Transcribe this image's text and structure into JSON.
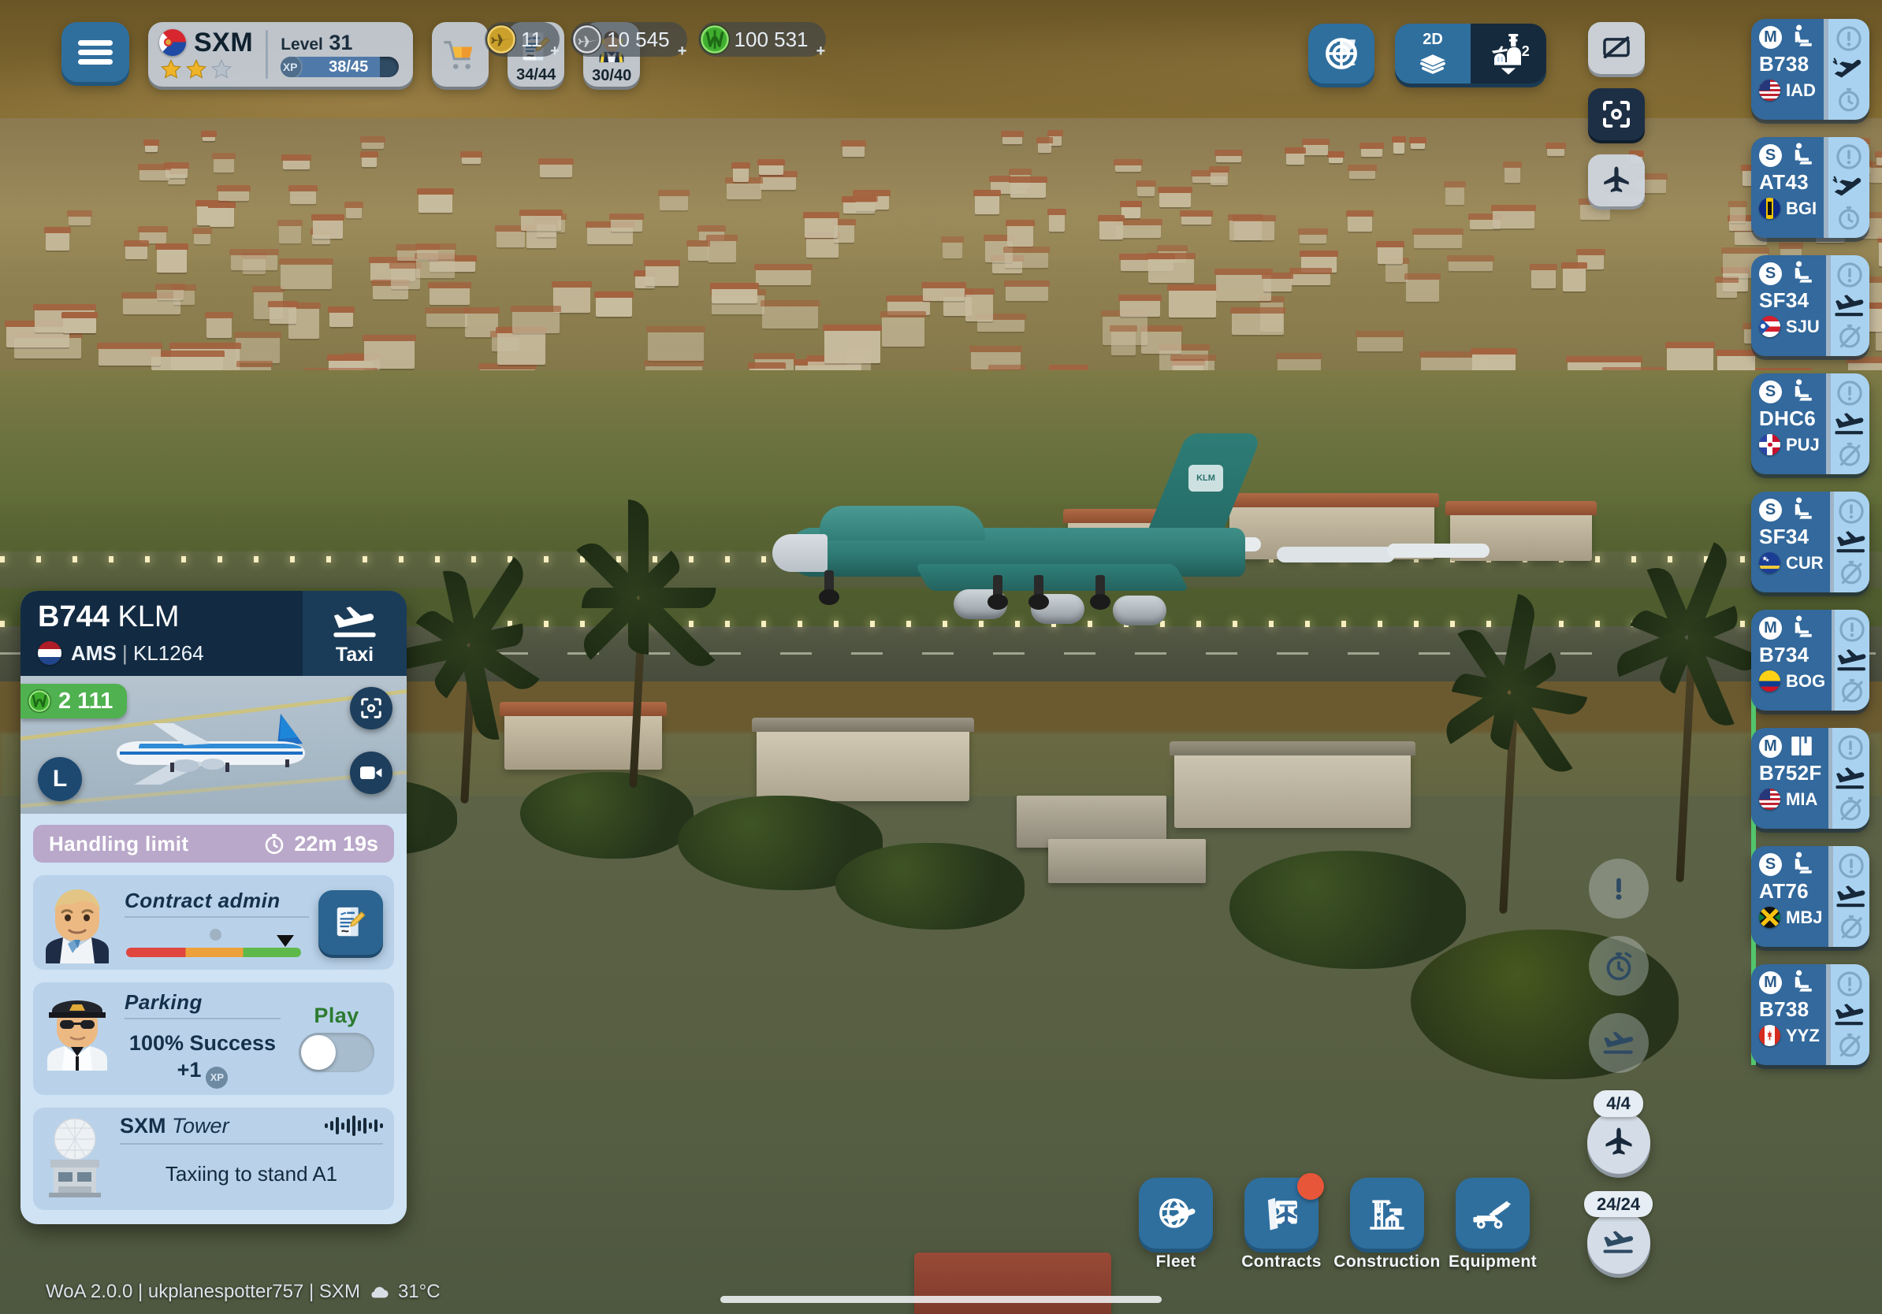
{
  "app": {
    "status_bar": "WoA 2.0.0 | ukplanespotter757 | SXM",
    "temperature": "31°C",
    "weather_icon": "cloud-icon"
  },
  "topbar": {
    "menu_icon": "hamburger-menu-icon",
    "airport": {
      "code": "SXM",
      "flag": "sint-maarten-flag",
      "stars_filled": 2,
      "stars_total": 3,
      "level_word": "Level",
      "level_number": "31",
      "xp_label": "XP",
      "xp_value": "38/45",
      "xp_percent": 84
    },
    "shop_button": {
      "icon": "shopping-cart-icon",
      "label": ""
    },
    "contracts_button": {
      "icon": "contract-document-icon",
      "count": "34/44"
    },
    "staff_button": {
      "icon": "ground-crew-icon",
      "count": "30/40"
    },
    "currencies": [
      {
        "name": "gold-plane-currency",
        "icon": "gold-plane-coin-icon",
        "value": "11",
        "color": "#caa12c"
      },
      {
        "name": "silver-plane-currency",
        "icon": "silver-plane-coin-icon",
        "value": "10 545",
        "color": "#b9bfc6"
      },
      {
        "name": "green-cash-currency",
        "icon": "green-w-coin-icon",
        "value": "100 531",
        "color": "#3fae2f"
      }
    ],
    "radar_button": {
      "icon": "radar-scope-icon"
    },
    "view_toggle": {
      "dimension_label": "2D",
      "dimension_icon": "layers-icon",
      "terminal_icon": "airport-terminal-icon",
      "terminal_count": "2",
      "chevron": "chevron-down-icon"
    },
    "right_controls": [
      {
        "name": "hide-labels-button",
        "icon": "screen-off-icon",
        "style": "light"
      },
      {
        "name": "focus-camera-button",
        "icon": "focus-frame-icon",
        "style": "dark"
      },
      {
        "name": "aircraft-filter-button",
        "icon": "plane-icon",
        "style": "light"
      }
    ]
  },
  "strips": [
    {
      "size": "M",
      "cargo_type": "passenger-seat-icon",
      "aircraft": "B738",
      "flag": "united-states-flag",
      "dest": "IAD",
      "movement": "departure-icon",
      "timer": "stopwatch-icon",
      "timer_disabled": false,
      "progress_pct": 28,
      "alert": "alert-circle-icon"
    },
    {
      "size": "S",
      "cargo_type": "passenger-seat-icon",
      "aircraft": "AT43",
      "flag": "barbados-flag",
      "dest": "BGI",
      "movement": "departure-icon",
      "timer": "stopwatch-icon",
      "timer_disabled": false,
      "progress_pct": 42,
      "alert": "alert-circle-icon"
    },
    {
      "size": "S",
      "cargo_type": "passenger-seat-icon",
      "aircraft": "SF34",
      "flag": "puerto-rico-flag",
      "dest": "SJU",
      "movement": "arrival-icon",
      "timer": "stopwatch-disabled-icon",
      "timer_disabled": true,
      "progress_pct": 0,
      "alert": "alert-circle-icon"
    },
    {
      "size": "S",
      "cargo_type": "passenger-seat-icon",
      "aircraft": "DHC6",
      "flag": "dominican-republic-flag",
      "dest": "PUJ",
      "movement": "arrival-icon",
      "timer": "stopwatch-disabled-icon",
      "timer_disabled": true,
      "progress_pct": 0,
      "alert": "alert-circle-icon"
    },
    {
      "size": "S",
      "cargo_type": "passenger-seat-icon",
      "aircraft": "SF34",
      "flag": "curacao-flag",
      "dest": "CUR",
      "movement": "arrival-icon",
      "timer": "stopwatch-disabled-icon",
      "timer_disabled": true,
      "progress_pct": 0,
      "alert": "alert-circle-icon"
    },
    {
      "size": "M",
      "cargo_type": "passenger-seat-icon",
      "aircraft": "B734",
      "flag": "colombia-flag",
      "dest": "BOG",
      "movement": "arrival-icon",
      "timer": "stopwatch-disabled-icon",
      "timer_disabled": true,
      "progress_pct": 0,
      "alert": "alert-circle-icon"
    },
    {
      "size": "M",
      "cargo_type": "cargo-boxes-icon",
      "aircraft": "B752F",
      "flag": "united-states-flag",
      "dest": "MIA",
      "movement": "arrival-icon",
      "timer": "stopwatch-disabled-icon",
      "timer_disabled": true,
      "progress_pct": 0,
      "alert": "alert-circle-icon"
    },
    {
      "size": "S",
      "cargo_type": "passenger-seat-icon",
      "aircraft": "AT76",
      "flag": "jamaica-flag",
      "dest": "MBJ",
      "movement": "arrival-icon",
      "timer": "stopwatch-disabled-icon",
      "timer_disabled": true,
      "progress_pct": 0,
      "alert": "alert-circle-icon"
    },
    {
      "size": "M",
      "cargo_type": "passenger-seat-icon",
      "aircraft": "B738",
      "flag": "canada-flag",
      "dest": "YYZ",
      "movement": "arrival-icon",
      "timer": "stopwatch-disabled-icon",
      "timer_disabled": true,
      "progress_pct": 0,
      "alert": "alert-circle-icon"
    }
  ],
  "aircraft_panel": {
    "type_code": "B744",
    "airline": "KLM",
    "origin_flag": "netherlands-flag",
    "origin": "AMS",
    "flight_number": "KL1264",
    "state_label": "Taxi",
    "state_icon": "landing-plane-icon",
    "reward_icon": "green-w-coin-icon",
    "reward_value": "2 111",
    "size_class": "L",
    "focus_icon": "focus-frame-icon",
    "camera_icon": "video-camera-icon",
    "handling": {
      "label": "Handling limit",
      "timer_icon": "stopwatch-icon",
      "time_left": "22m 19s"
    },
    "contract_admin": {
      "role": "Contract admin",
      "avatar": "contract-admin-avatar",
      "action_icon": "contract-document-icon",
      "skill_percent": 92
    },
    "parking": {
      "role": "Parking",
      "avatar": "pilot-avatar",
      "success_text": "100% Success",
      "xp_text": "+1",
      "xp_badge": "XP",
      "toggle_label": "Play",
      "toggle_on": false
    },
    "tower": {
      "airport": "SXM",
      "title_suffix": "Tower",
      "waveform_icon": "audio-waveform-icon",
      "message": "Taxiing to stand A1"
    }
  },
  "bottom_toolbar": [
    {
      "name": "fleet",
      "label": "Fleet",
      "icon": "globe-plane-icon",
      "badge": false
    },
    {
      "name": "contracts",
      "label": "Contracts",
      "icon": "tickets-icon",
      "badge": true
    },
    {
      "name": "construction",
      "label": "Construction",
      "icon": "crane-building-icon",
      "badge": false
    },
    {
      "name": "equipment",
      "label": "Equipment",
      "icon": "stair-truck-icon",
      "badge": false
    }
  ],
  "quick_controls": [
    {
      "name": "alerts-filter",
      "icon": "exclamation-icon",
      "style": "ghost",
      "label": ""
    },
    {
      "name": "timers-filter",
      "icon": "stopwatch-icon",
      "style": "ghost",
      "label": ""
    },
    {
      "name": "arrivals-filter",
      "icon": "arrival-icon",
      "style": "ghost",
      "label": ""
    },
    {
      "name": "departures-slots",
      "icon": "plane-icon",
      "style": "chip",
      "label": "4/4"
    },
    {
      "name": "stands-capacity",
      "icon": "arrival-icon",
      "style": "chip",
      "label": "24/24"
    }
  ]
}
